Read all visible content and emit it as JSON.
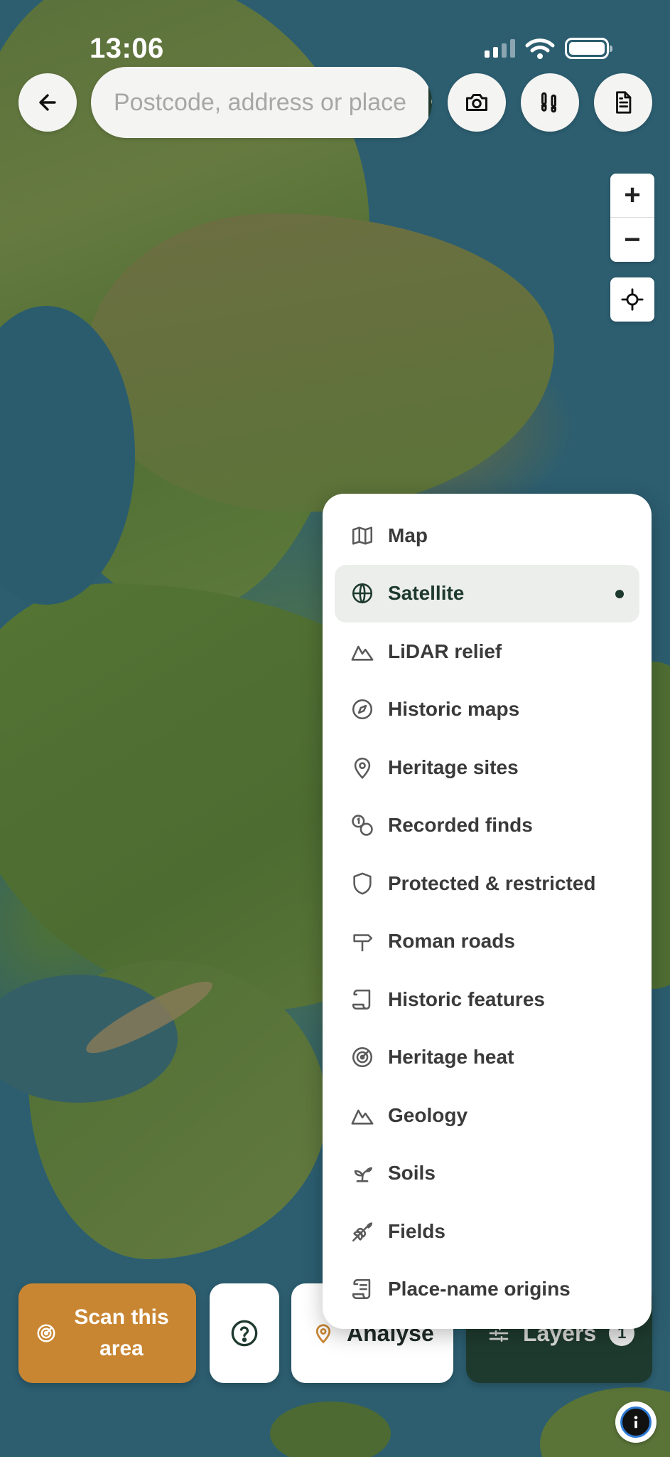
{
  "status_bar": {
    "time": "13:06"
  },
  "search": {
    "placeholder": "Postcode, address or place"
  },
  "zoom": {
    "in_label": "+",
    "out_label": "−"
  },
  "layers_menu": {
    "selected": "Satellite",
    "items": [
      {
        "label": "Map",
        "icon": "map-icon"
      },
      {
        "label": "Satellite",
        "icon": "globe-icon"
      },
      {
        "label": "LiDAR relief",
        "icon": "mountain-icon"
      },
      {
        "label": "Historic maps",
        "icon": "compass-icon"
      },
      {
        "label": "Heritage sites",
        "icon": "map-pin-icon"
      },
      {
        "label": "Recorded finds",
        "icon": "coins-icon"
      },
      {
        "label": "Protected & restricted",
        "icon": "shield-icon"
      },
      {
        "label": "Roman roads",
        "icon": "signpost-icon"
      },
      {
        "label": "Historic features",
        "icon": "scroll-icon"
      },
      {
        "label": "Heritage heat",
        "icon": "radar-icon"
      },
      {
        "label": "Geology",
        "icon": "mountain-icon"
      },
      {
        "label": "Soils",
        "icon": "sprout-icon"
      },
      {
        "label": "Fields",
        "icon": "wheat-icon"
      },
      {
        "label": "Place-name origins",
        "icon": "scroll-text-icon"
      }
    ]
  },
  "bottom_bar": {
    "scan_label": "Scan this area",
    "analyse_label": "Analyse",
    "layers_label": "Layers",
    "layers_count": "1"
  },
  "colors": {
    "brand_dark_green": "#1e3a2e",
    "scan_orange": "#c98632",
    "menu_active_bg": "#eceeec"
  }
}
